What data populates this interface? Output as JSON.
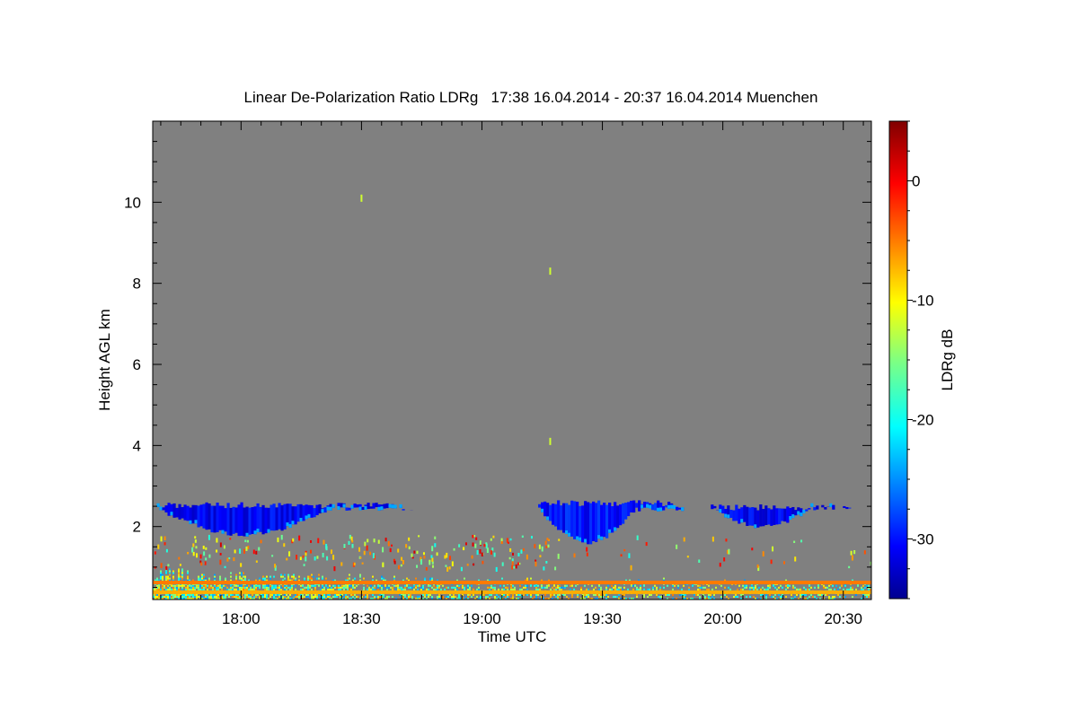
{
  "chart_data": {
    "type": "heatmap",
    "title": "Linear De-Polarization Ratio LDRg   17:38 16.04.2014 - 20:37 16.04.2014 Muenchen",
    "xlabel": "Time UTC",
    "ylabel": "Height AGL km",
    "colorbar_label": "LDRg dB",
    "x_range_minutes_utc": [
      "17:38",
      "20:37"
    ],
    "ylim_km": [
      0.2,
      12.0
    ],
    "x_ticks": [
      "18:00",
      "18:30",
      "19:00",
      "19:30",
      "20:00",
      "20:30"
    ],
    "y_ticks": [
      2,
      4,
      6,
      8,
      10
    ],
    "colorbar_range_db": [
      -35,
      5
    ],
    "colorbar_ticks": [
      0,
      -10,
      -20,
      -30
    ],
    "background": "no signal (gray)",
    "cloud_layers": [
      {
        "start": "17:39",
        "end": "18:48",
        "bottom_km": 1.75,
        "top_km": 2.6,
        "ldr_db": -31
      },
      {
        "start": "19:14",
        "end": "19:53",
        "bottom_km": 1.55,
        "top_km": 2.65,
        "ldr_db": -30
      },
      {
        "start": "19:57",
        "end": "20:37",
        "bottom_km": 1.95,
        "top_km": 2.55,
        "ldr_db": -31
      }
    ],
    "boundary_layer": {
      "bottom_km": 0.2,
      "top_km": 1.0,
      "ldr_db_range": [
        -25,
        -5
      ]
    },
    "artifact_lines_km": [
      {
        "height": 0.62,
        "ldr_db": -5
      },
      {
        "height": 0.38,
        "ldr_db": -7
      }
    ],
    "isolated_echoes": [
      {
        "time": "18:30",
        "height_km": 10.1,
        "ldr_db": -12
      },
      {
        "time": "19:17",
        "height_km": 8.3,
        "ldr_db": -12
      },
      {
        "time": "19:17",
        "height_km": 4.1,
        "ldr_db": -12
      }
    ]
  },
  "colors": {
    "background_gray": "#808080",
    "cloud_blue": "#1c3cf0",
    "artifact_orange": "#ff8000"
  }
}
